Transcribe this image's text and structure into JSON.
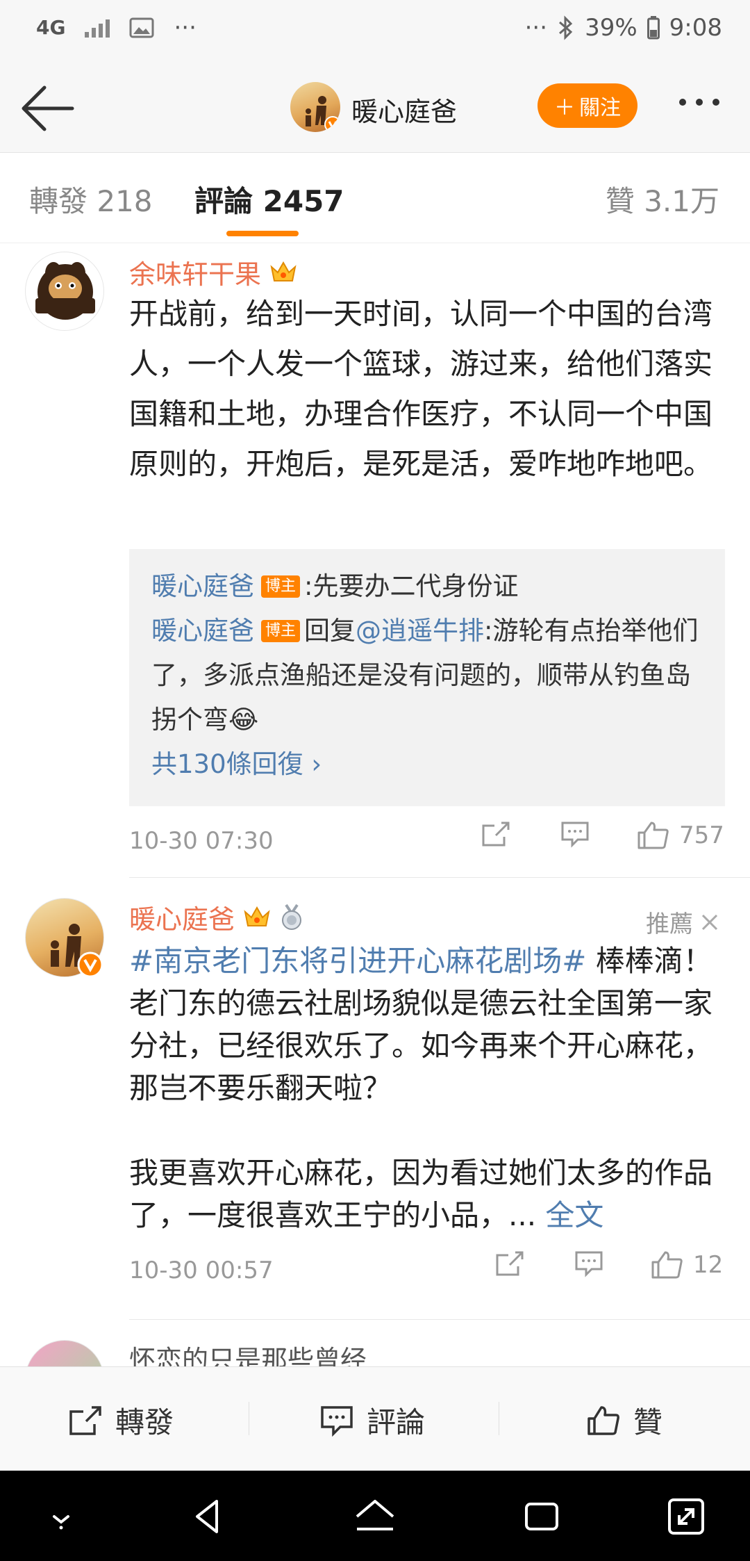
{
  "status_bar": {
    "network": "4G",
    "more": "···",
    "more_right": "···",
    "battery": "39%",
    "time": "9:08"
  },
  "header": {
    "name": "暖心庭爸",
    "follow_label": "關注",
    "follow_plus": "＋"
  },
  "tabs": {
    "repost": "轉發 218",
    "comments": "評論 2457",
    "likes": "贊 3.1万"
  },
  "comments": [
    {
      "name": "余味轩干果",
      "text": "开战前，给到一天时间，认同一个中国的台湾人，一个人发一个篮球，游过来，给他们落实国籍和土地，办理合作医疗，不认同一个中国原则的，开炮后，是死是活，爱咋地咋地吧。",
      "replies": [
        {
          "name": "暖心庭爸",
          "badge": "博主",
          "text": ":先要办二代身份证"
        },
        {
          "name": "暖心庭爸",
          "badge": "博主",
          "prefix": "回复",
          "at": "@逍遥牛排",
          "text": ":游轮有点抬举他们了，多派点渔船还是没有问题的，顺带从钓鱼岛拐个弯😂"
        }
      ],
      "more_replies": "共130條回復 ›",
      "time": "10-30 07:30",
      "like_count": "757"
    },
    {
      "name": "暖心庭爸",
      "recommend": "推薦",
      "topic": "#南京老门东将引进开心麻花剧场#",
      "text_p1": " 棒棒滴！老门东的德云社剧场貌似是德云社全国第一家分社，已经很欢乐了。如今再来个开心麻花，那岂不要乐翻天啦？",
      "text_p2": "我更喜欢开心麻花，因为看过她们太多的作品了，一度很喜欢王宁的小品，...",
      "full_text": "全文",
      "time": "10-30 00:57",
      "like_count": "12"
    },
    {
      "name": "怀恋的只是那些曾经"
    }
  ],
  "bottom_bar": {
    "repost": "轉發",
    "comment": "評論",
    "like": "贊"
  },
  "icons": {
    "accent": "#ff8200",
    "link": "#507daf",
    "username": "#eb7350"
  }
}
